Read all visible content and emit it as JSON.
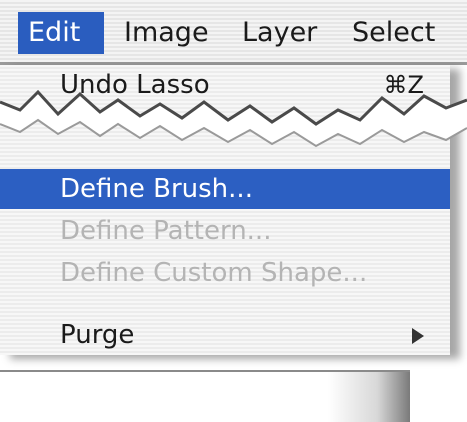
{
  "menubar": {
    "items": [
      {
        "label": "Edit",
        "active": true
      },
      {
        "label": "Image",
        "active": false
      },
      {
        "label": "Layer",
        "active": false
      },
      {
        "label": "Select",
        "active": false
      }
    ]
  },
  "edit_menu": {
    "items": [
      {
        "label": "Undo Lasso",
        "shortcut": "⌘Z",
        "state": "enabled"
      },
      {
        "label": "Define Brush...",
        "state": "highlighted"
      },
      {
        "label": "Define Pattern...",
        "state": "disabled"
      },
      {
        "label": "Define Custom Shape...",
        "state": "disabled"
      },
      {
        "label": "Purge",
        "state": "enabled",
        "has_submenu": true
      }
    ]
  },
  "colors": {
    "highlight": "#2c5fc2",
    "disabled_text": "#b4b4b4",
    "menu_stripe_light": "#f7f7f7",
    "menu_stripe_dark": "#ececec"
  },
  "icons": {
    "submenu": "triangle-right-icon"
  }
}
